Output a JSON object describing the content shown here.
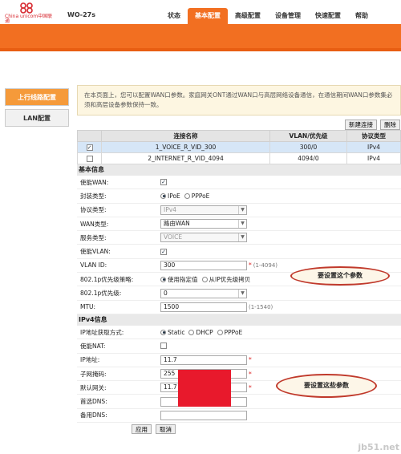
{
  "header": {
    "logo_text": "China unicom中国联通",
    "model": "WO-27s",
    "tabs": [
      {
        "label": "状态"
      },
      {
        "label": "基本配置",
        "active": true
      },
      {
        "label": "高级配置"
      },
      {
        "label": "设备管理"
      },
      {
        "label": "快速配置"
      },
      {
        "label": "帮助"
      }
    ],
    "accent_color": "#f26f21"
  },
  "sidebar": {
    "items": [
      {
        "label": "上行线路配置",
        "active": true
      },
      {
        "label": "LAN配置"
      }
    ]
  },
  "notice": "在本页面上，您可以配置WAN口参数。家庭网关ONT通过WAN口与高层网络设备通信，在通信期间WAN口参数集必须和高层设备参数保持一致。",
  "toolbar": {
    "new_label": "新建连接",
    "delete_label": "删除"
  },
  "wan_table": {
    "headers": [
      "",
      "连接名称",
      "VLAN/优先级",
      "协议类型"
    ],
    "rows": [
      {
        "checked": true,
        "name": "1_VOICE_R_VID_300",
        "vlan": "300/0",
        "protocol": "IPv4"
      },
      {
        "checked": false,
        "name": "2_INTERNET_R_VID_4094",
        "vlan": "4094/0",
        "protocol": "IPv4"
      }
    ]
  },
  "basic": {
    "title": "基本信息",
    "enable_wan_label": "使能WAN:",
    "encap_label": "封装类型:",
    "encap_opt1": "IPoE",
    "encap_opt2": "PPPoE",
    "proto_label": "协议类型:",
    "proto_value": "IPv4",
    "wan_type_label": "WAN类型:",
    "wan_type_value": "路由WAN",
    "service_label": "服务类型:",
    "service_value": "VOICE",
    "enable_vlan_label": "使能VLAN:",
    "vlan_id_label": "VLAN ID:",
    "vlan_id_value": "300",
    "vlan_id_hint": "(1-4094)",
    "policy_label": "802.1p优先级策略:",
    "policy_opt1": "使用指定值",
    "policy_opt2": "从IP优先级拷贝",
    "prio_label": "802.1p优先级:",
    "prio_value": "0",
    "mtu_label": "MTU:",
    "mtu_value": "1500",
    "mtu_hint": "(1-1540)"
  },
  "ipv4": {
    "title": "IPv4信息",
    "mode_label": "IP地址获取方式:",
    "mode_opt1": "Static",
    "mode_opt2": "DHCP",
    "mode_opt3": "PPPoE",
    "nat_label": "使能NAT:",
    "ip_label": "IP地址:",
    "ip_value": "11.7",
    "mask_label": "子网掩码:",
    "mask_value": "255",
    "gw_label": "默认网关:",
    "gw_value": "11.7",
    "dns1_label": "首选DNS:",
    "dns2_label": "备用DNS:"
  },
  "actions": {
    "apply_label": "应用",
    "cancel_label": "取消"
  },
  "annotations": {
    "callout1": "要设置这个参数",
    "callout2": "要设置这些参数"
  },
  "watermark": "jb51.net"
}
